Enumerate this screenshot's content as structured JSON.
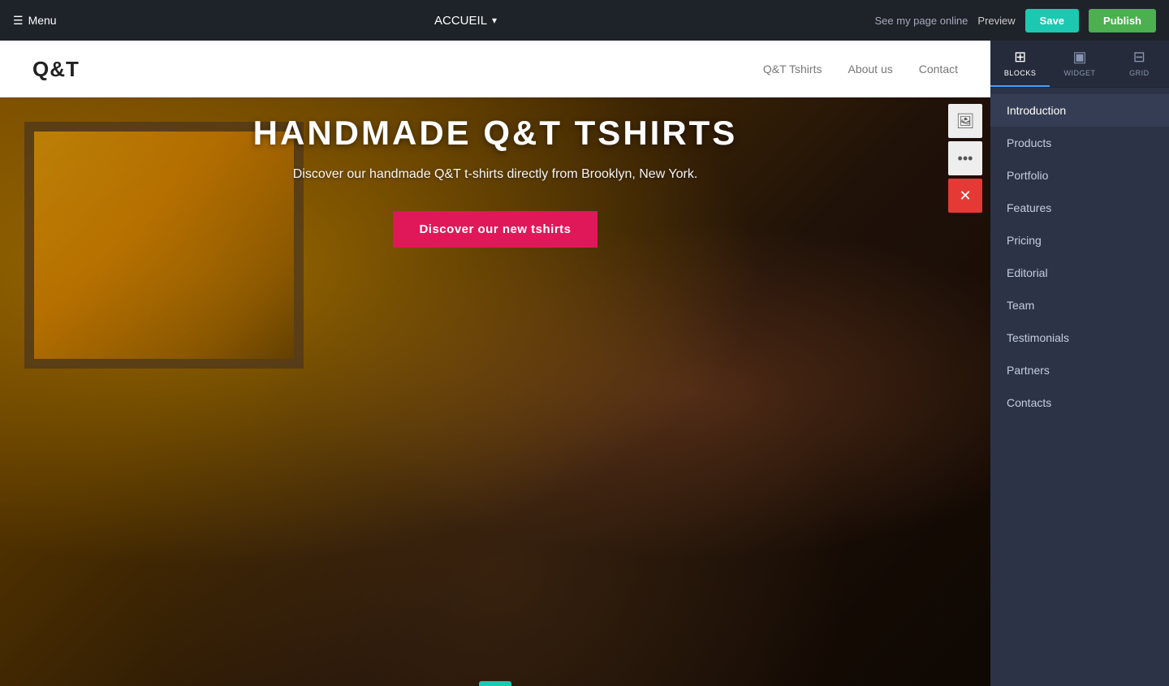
{
  "topbar": {
    "menu_icon": "☰",
    "menu_label": "Menu",
    "page_name": "ACCUEIL",
    "chevron": "▾",
    "see_online": "See my page online",
    "preview": "Preview",
    "save_label": "Save",
    "publish_label": "Publish"
  },
  "site": {
    "logo": "Q&T",
    "nav_links": [
      {
        "label": "Q&T Tshirts"
      },
      {
        "label": "About us"
      },
      {
        "label": "Contact"
      }
    ]
  },
  "hero": {
    "title": "HANDMADE Q&T TSHIRTS",
    "subtitle": "Discover our handmade Q&T t-shirts directly from Brooklyn, New York.",
    "cta_label": "Discover our new tshirts"
  },
  "side_toolbar": {
    "image_icon": "🖼",
    "dots_icon": "···",
    "close_icon": "✕"
  },
  "right_panel": {
    "tabs": [
      {
        "id": "blocks",
        "icon": "⊞",
        "label": "BLOCKS",
        "active": true
      },
      {
        "id": "widget",
        "icon": "▣",
        "label": "WIDGET",
        "active": false
      },
      {
        "id": "grid",
        "icon": "⊟",
        "label": "GRID",
        "active": false
      }
    ],
    "items": [
      {
        "id": "introduction",
        "label": "Introduction",
        "active": true
      },
      {
        "id": "products",
        "label": "Products"
      },
      {
        "id": "portfolio",
        "label": "Portfolio"
      },
      {
        "id": "features",
        "label": "Features"
      },
      {
        "id": "pricing",
        "label": "Pricing"
      },
      {
        "id": "editorial",
        "label": "Editorial"
      },
      {
        "id": "team",
        "label": "Team"
      },
      {
        "id": "testimonials",
        "label": "Testimonials"
      },
      {
        "id": "partners",
        "label": "Partners"
      },
      {
        "id": "contacts",
        "label": "Contacts"
      }
    ]
  }
}
